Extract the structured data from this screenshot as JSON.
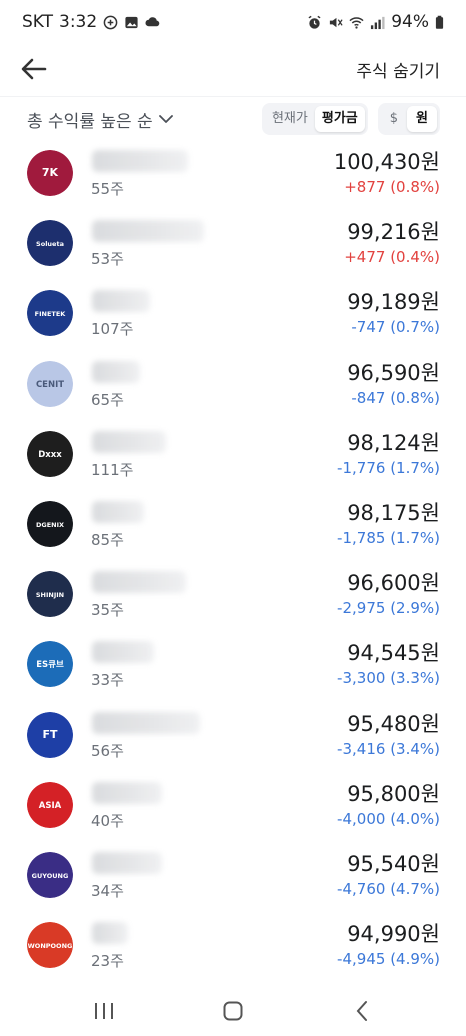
{
  "status_bar": {
    "carrier": "SKT",
    "time": "3:32",
    "battery": "94%"
  },
  "header": {
    "hide_label": "주식 숨기기"
  },
  "filter": {
    "sort_label": "총 수익률 높은 순",
    "price_options": [
      "현재가",
      "평가금"
    ],
    "currency_options": [
      "$",
      "원"
    ]
  },
  "stocks": [
    {
      "shares": "55주",
      "amount": "100,430원",
      "change": "+877",
      "rate": "(0.8%)",
      "dir": "up",
      "logo_color": "#a01a3d",
      "logo_text": "7K",
      "name_w": 96
    },
    {
      "shares": "53주",
      "amount": "99,216원",
      "change": "+477",
      "rate": "(0.4%)",
      "dir": "up",
      "logo_color": "#1d2f6e",
      "logo_text": "Solueta",
      "name_w": 112
    },
    {
      "shares": "107주",
      "amount": "99,189원",
      "change": "-747",
      "rate": "(0.7%)",
      "dir": "down",
      "logo_color": "#1d3a8a",
      "logo_text": "FINETEK",
      "name_w": 58
    },
    {
      "shares": "65주",
      "amount": "96,590원",
      "change": "-847",
      "rate": "(0.8%)",
      "dir": "down",
      "logo_color": "#b9c7e6",
      "logo_text": "CENIT",
      "name_w": 48
    },
    {
      "shares": "111주",
      "amount": "98,124원",
      "change": "-1,776",
      "rate": "(1.7%)",
      "dir": "down",
      "logo_color": "#1e1e1e",
      "logo_text": "Dxxx",
      "name_w": 74
    },
    {
      "shares": "85주",
      "amount": "98,175원",
      "change": "-1,785",
      "rate": "(1.7%)",
      "dir": "down",
      "logo_color": "#14171c",
      "logo_text": "DGENIX",
      "name_w": 52
    },
    {
      "shares": "35주",
      "amount": "96,600원",
      "change": "-2,975",
      "rate": "(2.9%)",
      "dir": "down",
      "logo_color": "#1f2d4c",
      "logo_text": "SHINJIN",
      "name_w": 94
    },
    {
      "shares": "33주",
      "amount": "94,545원",
      "change": "-3,300",
      "rate": "(3.3%)",
      "dir": "down",
      "logo_color": "#1c6cb8",
      "logo_text": "ES큐브",
      "name_w": 62
    },
    {
      "shares": "56주",
      "amount": "95,480원",
      "change": "-3,416",
      "rate": "(3.4%)",
      "dir": "down",
      "logo_color": "#1e3fa6",
      "logo_text": "FT",
      "name_w": 108
    },
    {
      "shares": "40주",
      "amount": "95,800원",
      "change": "-4,000",
      "rate": "(4.0%)",
      "dir": "down",
      "logo_color": "#d42126",
      "logo_text": "ASIA",
      "name_w": 70
    },
    {
      "shares": "34주",
      "amount": "95,540원",
      "change": "-4,760",
      "rate": "(4.7%)",
      "dir": "down",
      "logo_color": "#3a2d85",
      "logo_text": "GUYOUNG",
      "name_w": 70
    },
    {
      "shares": "23주",
      "amount": "94,990원",
      "change": "-4,945",
      "rate": "(4.9%)",
      "dir": "down",
      "logo_color": "#d93a26",
      "logo_text": "WONPOONG",
      "name_w": 36
    }
  ],
  "icons": {
    "back": "arrow-left-icon",
    "sort": "chevron-down-icon",
    "nav": [
      "recent-apps-icon",
      "home-icon",
      "back-nav-icon"
    ]
  }
}
